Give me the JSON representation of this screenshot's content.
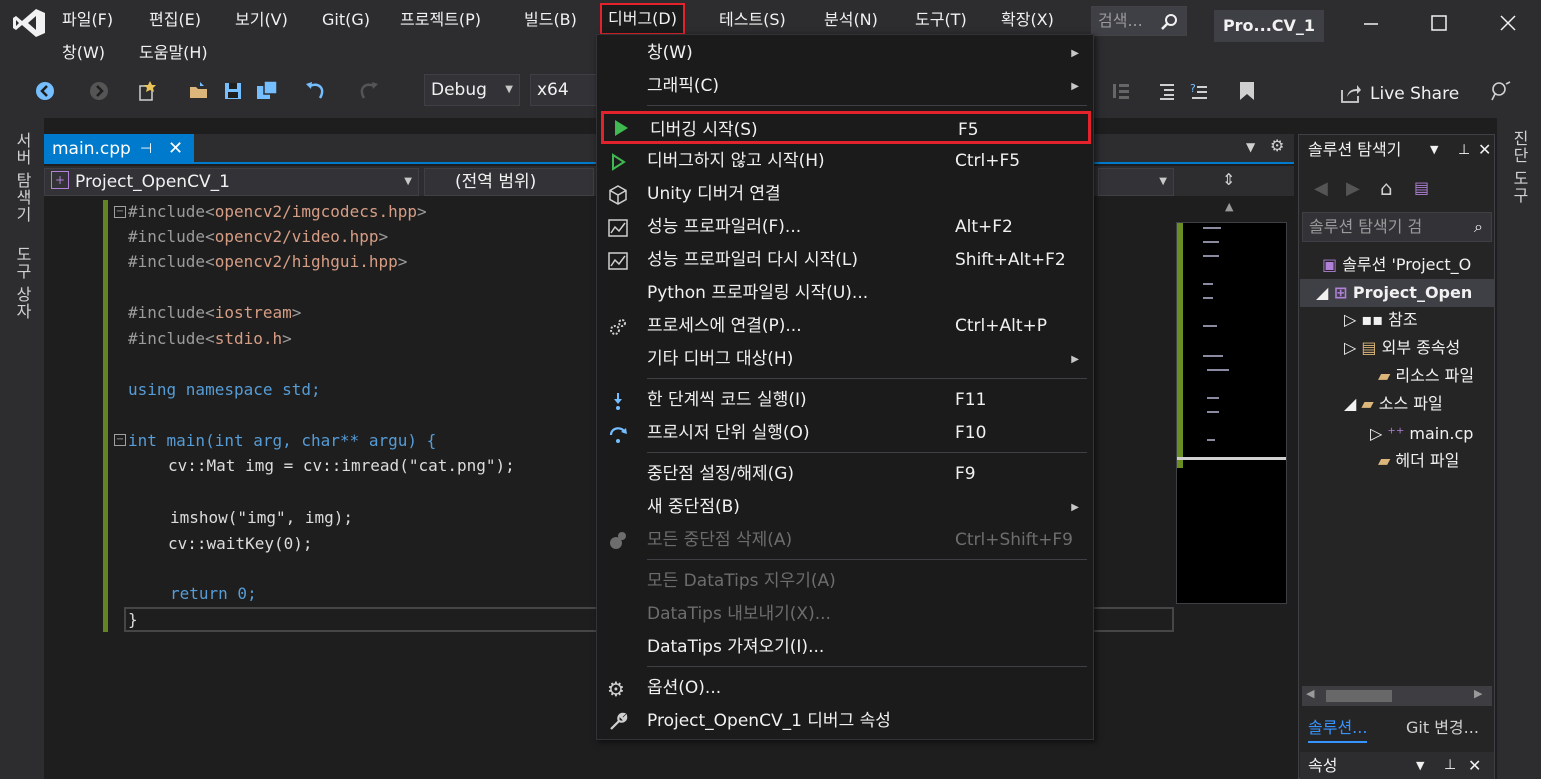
{
  "menubar": {
    "row1": [
      "파일(F)",
      "편집(E)",
      "보기(V)",
      "Git(G)",
      "프로젝트(P)",
      "빌드(B)",
      "디버그(D)",
      "테스트(S)",
      "분석(N)",
      "도구(T)",
      "확장(X)"
    ],
    "row2": [
      "창(W)",
      "도움말(H)"
    ],
    "search_placeholder": "검색...",
    "project_title": "Pro...CV_1"
  },
  "toolbar": {
    "config": "Debug",
    "platform": "x64",
    "live_share": "Live Share"
  },
  "left_strip": {
    "server_explorer": "서버 탐색기",
    "toolbox": "도구 상자"
  },
  "right_strip": {
    "diagnostics": "진단 도구"
  },
  "editor": {
    "tab": "main.cpp",
    "nav_project": "Project_OpenCV_1",
    "nav_scope": "(전역 범위)"
  },
  "code": [
    {
      "pre": "#include<",
      "inc": "opencv2/imgcodecs.hpp",
      "post": ">"
    },
    {
      "pre": "#include<",
      "inc": "opencv2/video.hpp",
      "post": ">"
    },
    {
      "pre": "#include<",
      "inc": "opencv2/highgui.hpp",
      "post": ">"
    },
    {
      "pre": "#include<",
      "inc": "iostream",
      "post": ">"
    },
    {
      "pre": "#include<",
      "inc": "stdio.h",
      "post": ">"
    },
    {
      "text": "using namespace std;"
    },
    {
      "text": "int main(int arg, char** argu) {"
    },
    {
      "text": "cv::Mat img = cv::imread(\"cat.png\");"
    },
    {
      "text": "imshow(\"img\", img);"
    },
    {
      "text": "cv::waitKey(0);"
    },
    {
      "text": "return 0;"
    },
    {
      "text": "}"
    }
  ],
  "solution_explorer": {
    "title": "솔루션 탐색기",
    "search_placeholder": "솔루션 탐색기 검",
    "items": [
      "솔루션 'Project_O",
      "Project_Open",
      "참조",
      "외부 종속성",
      "리소스 파일",
      "소스 파일",
      "main.cp",
      "헤더 파일"
    ],
    "tabs": [
      "솔루션...",
      "Git 변경..."
    ],
    "properties_title": "속성"
  },
  "debug_menu": {
    "items": [
      {
        "label": "창(W)",
        "shortcut": "",
        "submenu": true,
        "disabled": false
      },
      {
        "label": "그래픽(C)",
        "shortcut": "",
        "submenu": true,
        "disabled": false
      },
      {
        "label": "디버깅 시작(S)",
        "shortcut": "F5",
        "submenu": false,
        "disabled": false
      },
      {
        "label": "디버그하지 않고 시작(H)",
        "shortcut": "Ctrl+F5",
        "submenu": false,
        "disabled": false
      },
      {
        "label": "Unity 디버거 연결",
        "shortcut": "",
        "submenu": false,
        "disabled": false
      },
      {
        "label": "성능 프로파일러(F)...",
        "shortcut": "Alt+F2",
        "submenu": false,
        "disabled": false
      },
      {
        "label": "성능 프로파일러 다시 시작(L)",
        "shortcut": "Shift+Alt+F2",
        "submenu": false,
        "disabled": false
      },
      {
        "label": "Python 프로파일링 시작(U)...",
        "shortcut": "",
        "submenu": false,
        "disabled": false
      },
      {
        "label": "프로세스에 연결(P)...",
        "shortcut": "Ctrl+Alt+P",
        "submenu": false,
        "disabled": false
      },
      {
        "label": "기타 디버그 대상(H)",
        "shortcut": "",
        "submenu": true,
        "disabled": false
      },
      {
        "label": "한 단계씩 코드 실행(I)",
        "shortcut": "F11",
        "submenu": false,
        "disabled": false
      },
      {
        "label": "프로시저 단위 실행(O)",
        "shortcut": "F10",
        "submenu": false,
        "disabled": false
      },
      {
        "label": "중단점 설정/해제(G)",
        "shortcut": "F9",
        "submenu": false,
        "disabled": false
      },
      {
        "label": "새 중단점(B)",
        "shortcut": "",
        "submenu": true,
        "disabled": false
      },
      {
        "label": "모든 중단점 삭제(A)",
        "shortcut": "Ctrl+Shift+F9",
        "submenu": false,
        "disabled": true
      },
      {
        "label": "모든 DataTips 지우기(A)",
        "shortcut": "",
        "submenu": false,
        "disabled": true
      },
      {
        "label": "DataTips 내보내기(X)...",
        "shortcut": "",
        "submenu": false,
        "disabled": true
      },
      {
        "label": "DataTips 가져오기(I)...",
        "shortcut": "",
        "submenu": false,
        "disabled": false
      },
      {
        "label": "옵션(O)...",
        "shortcut": "",
        "submenu": false,
        "disabled": false
      },
      {
        "label": "Project_OpenCV_1 디버그 속성",
        "shortcut": "",
        "submenu": false,
        "disabled": false
      }
    ]
  },
  "colors": {
    "accent": "#007acc",
    "highlight_border": "#e3222b",
    "play_green": "#3fb950",
    "vs_purple": "#b180d7"
  }
}
